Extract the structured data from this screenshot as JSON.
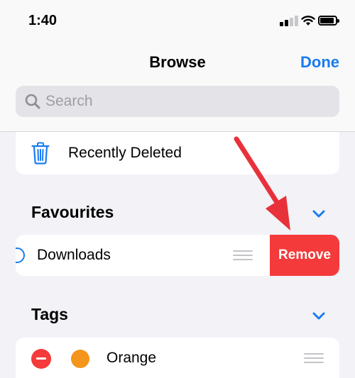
{
  "status_bar": {
    "time": "1:40"
  },
  "nav": {
    "title": "Browse",
    "done_label": "Done"
  },
  "search": {
    "placeholder": "Search"
  },
  "locations": {
    "recently_deleted_label": "Recently Deleted"
  },
  "favourites": {
    "title": "Favourites",
    "item_label": "Downloads",
    "remove_label": "Remove"
  },
  "tags": {
    "title": "Tags",
    "item_label": "Orange",
    "item_color": "#f3961b"
  },
  "colors": {
    "accent": "#1a7cf0",
    "destructive": "#f43a3a",
    "arrow": "#e8313a"
  }
}
